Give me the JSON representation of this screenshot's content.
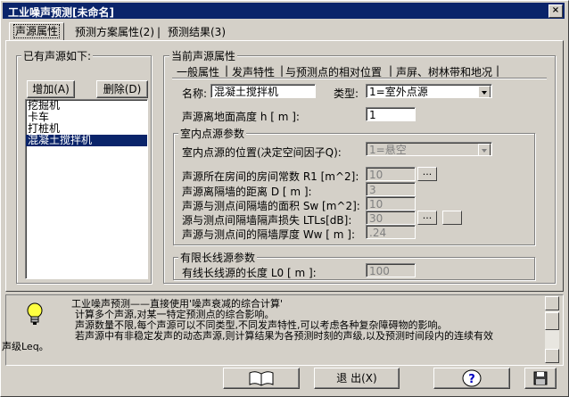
{
  "window": {
    "title": "工业噪声预测[未命名]",
    "close": "×"
  },
  "tabs": [
    {
      "label": "声源属性"
    },
    {
      "label": "预测方案属性(2)"
    },
    {
      "label": "预测结果(3)"
    }
  ],
  "left": {
    "group_label": "已有声源如下:",
    "add_button": "增加(A)",
    "delete_button": "删除(D)",
    "sources": [
      "挖掘机",
      "卡车",
      "打桩机",
      "混凝土搅拌机"
    ],
    "selected_index": 3
  },
  "right": {
    "group_label": "当前声源属性",
    "subtabs": [
      "一般属性",
      "发声特性",
      "与预测点的相对位置",
      "声屏、树林带和地况"
    ],
    "name_label": "名称:",
    "name_value": "混凝土搅拌机",
    "type_label": "类型:",
    "type_value": "1=室外点源",
    "height_label": "声源离地面高度   h [ m ]:",
    "height_value": "1",
    "indoor": {
      "group_label": "室内点源参数",
      "position_label": "室内点源的位置(决定空间因子Q):",
      "position_value": "1=悬空",
      "rows": [
        {
          "label": "声源所在房间的房间常数 R1 [m^2]:",
          "value": "10"
        },
        {
          "label": "声源离隔墙的距离        D  [ m ]:",
          "value": "3"
        },
        {
          "label": "声源与测点间隔墙的面积  Sw [m^2]:",
          "value": "10"
        },
        {
          "label": "源与测点间隔墙隔声损失  LTLs[dB]:",
          "value": "30"
        },
        {
          "label": "声源与测点间的隔墙厚度  Ww [ m ]:",
          "value": ".24"
        }
      ],
      "dots": "..."
    },
    "line_source": {
      "group_label": "有限长线源参数",
      "length_label": "有线长线源的长度            L0 [ m ]:",
      "length_value": "100"
    }
  },
  "info": {
    "lines": [
      "工业噪声预测——直接使用'噪声衰减的综合计算'",
      "计算多个声源,对某一特定预测点的综合影响。",
      "声源数量不限,每个声源可以不同类型,不同发声特性,可以考虑各种复杂障碍物的影响。",
      "若声源中有非稳定发声的动态声源,则计算结果为各预测时刻的声级,以及预测时间段内的连续有效",
      "声级Leq。"
    ]
  },
  "bottom": {
    "exit_button": "退 出(X)",
    "icons": [
      "book-icon",
      "help-icon",
      "save-icon",
      "lightbulb-icon"
    ]
  }
}
